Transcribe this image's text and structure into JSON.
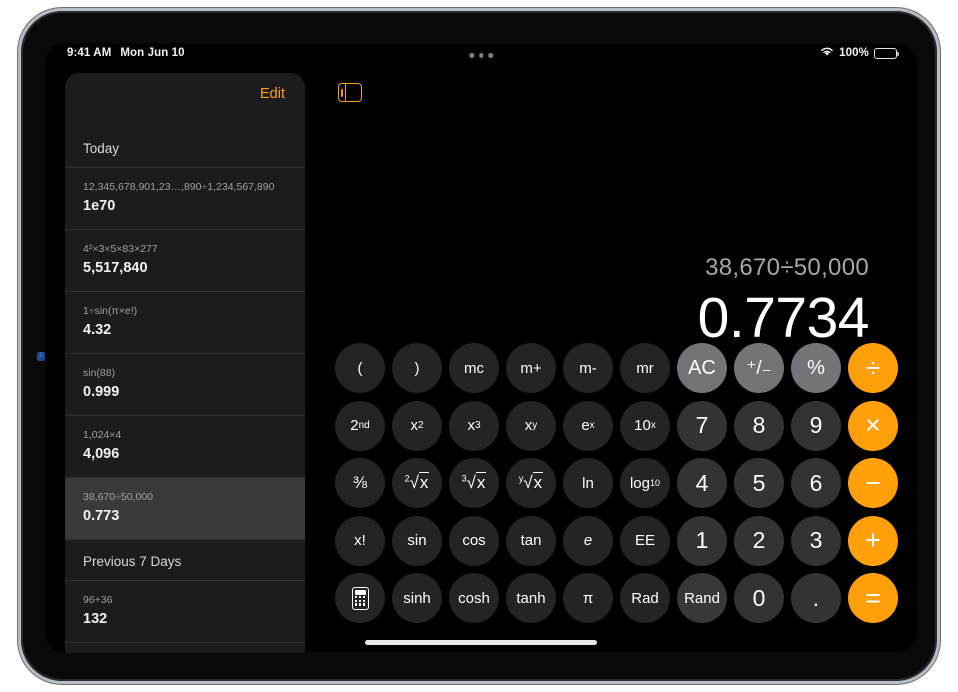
{
  "status_bar": {
    "time": "9:41 AM",
    "date": "Mon Jun 10",
    "wifi_icon": "wifi-icon",
    "battery_percent": "100%"
  },
  "multitask": {
    "icon": "more-dots-icon"
  },
  "sidebar": {
    "edit_label": "Edit",
    "toggle_icon": "sidebar-toggle-icon",
    "sections": [
      {
        "title": "Today",
        "rows": [
          {
            "expression": "12,345,678,901,23…,890÷1,234,567,890",
            "result": "1e70",
            "selected": false
          },
          {
            "expression": "4²×3×5×83×277",
            "result": "5,517,840",
            "selected": false
          },
          {
            "expression": "1÷sin(π×e!)",
            "result": "4.32",
            "selected": false
          },
          {
            "expression": "sin(88)",
            "result": "0.999",
            "selected": false
          },
          {
            "expression": "1,024×4",
            "result": "4,096",
            "selected": false
          },
          {
            "expression": "38,670÷50,000",
            "result": "0.773",
            "selected": true
          }
        ]
      },
      {
        "title": "Previous 7 Days",
        "rows": [
          {
            "expression": "96+36",
            "result": "132",
            "selected": false
          }
        ]
      }
    ]
  },
  "display": {
    "expression": "38,670÷50,000",
    "result": "0.7734"
  },
  "keypad": {
    "rows": [
      [
        {
          "name": "open-paren",
          "label": "(",
          "style": "fn"
        },
        {
          "name": "close-paren",
          "label": ")",
          "style": "fn"
        },
        {
          "name": "memory-clear",
          "label": "mc",
          "style": "fn"
        },
        {
          "name": "memory-add",
          "label": "m+",
          "style": "fn"
        },
        {
          "name": "memory-subtract",
          "label": "m-",
          "style": "fn"
        },
        {
          "name": "memory-recall",
          "label": "mr",
          "style": "fn"
        },
        {
          "name": "all-clear",
          "label": "AC",
          "style": "util"
        },
        {
          "name": "plus-minus",
          "label": "+/-",
          "style": "util"
        },
        {
          "name": "percent",
          "label": "%",
          "style": "util"
        },
        {
          "name": "divide",
          "label": "÷",
          "style": "op"
        }
      ],
      [
        {
          "name": "second-function",
          "label": "2nd",
          "style": "fn",
          "sup": "nd",
          "base": "2"
        },
        {
          "name": "x-squared",
          "label": "x²",
          "style": "fn",
          "sup": "2",
          "base": "x"
        },
        {
          "name": "x-cubed",
          "label": "x³",
          "style": "fn",
          "sup": "3",
          "base": "x"
        },
        {
          "name": "x-to-the-y",
          "label": "xʸ",
          "style": "fn",
          "sup": "y",
          "base": "x"
        },
        {
          "name": "e-to-the-x",
          "label": "eˣ",
          "style": "fn",
          "sup": "x",
          "base": "e"
        },
        {
          "name": "ten-to-the-x",
          "label": "10ˣ",
          "style": "fn",
          "sup": "x",
          "base": "10"
        },
        {
          "name": "digit-7",
          "label": "7",
          "style": "digit"
        },
        {
          "name": "digit-8",
          "label": "8",
          "style": "digit"
        },
        {
          "name": "digit-9",
          "label": "9",
          "style": "digit"
        },
        {
          "name": "multiply",
          "label": "×",
          "style": "op"
        }
      ],
      [
        {
          "name": "reciprocal",
          "label": "1/x",
          "style": "fn"
        },
        {
          "name": "square-root",
          "label": "²√x",
          "style": "fn",
          "root": "2"
        },
        {
          "name": "cube-root",
          "label": "³√x",
          "style": "fn",
          "root": "3"
        },
        {
          "name": "y-root",
          "label": "ʸ√x",
          "style": "fn",
          "root": "y"
        },
        {
          "name": "natural-log",
          "label": "ln",
          "style": "fn"
        },
        {
          "name": "log-base-10",
          "label": "log10",
          "style": "fn",
          "base": "log",
          "sub": "10"
        },
        {
          "name": "digit-4",
          "label": "4",
          "style": "digit"
        },
        {
          "name": "digit-5",
          "label": "5",
          "style": "digit"
        },
        {
          "name": "digit-6",
          "label": "6",
          "style": "digit"
        },
        {
          "name": "subtract",
          "label": "−",
          "style": "op"
        }
      ],
      [
        {
          "name": "factorial",
          "label": "x!",
          "style": "fn"
        },
        {
          "name": "sine",
          "label": "sin",
          "style": "fn"
        },
        {
          "name": "cosine",
          "label": "cos",
          "style": "fn"
        },
        {
          "name": "tangent",
          "label": "tan",
          "style": "fn"
        },
        {
          "name": "euler-number",
          "label": "e",
          "style": "fn",
          "italic": true
        },
        {
          "name": "exponent-entry",
          "label": "EE",
          "style": "fn"
        },
        {
          "name": "digit-1",
          "label": "1",
          "style": "digit"
        },
        {
          "name": "digit-2",
          "label": "2",
          "style": "digit"
        },
        {
          "name": "digit-3",
          "label": "3",
          "style": "digit"
        },
        {
          "name": "add",
          "label": "+",
          "style": "op"
        }
      ],
      [
        {
          "name": "calculator-mode",
          "label": "",
          "style": "fn",
          "icon": "calculator-icon"
        },
        {
          "name": "hyperbolic-sine",
          "label": "sinh",
          "style": "fn"
        },
        {
          "name": "hyperbolic-cosine",
          "label": "cosh",
          "style": "fn"
        },
        {
          "name": "hyperbolic-tangent",
          "label": "tanh",
          "style": "fn"
        },
        {
          "name": "pi",
          "label": "π",
          "style": "fn"
        },
        {
          "name": "radians-toggle",
          "label": "Rad",
          "style": "fn"
        },
        {
          "name": "random",
          "label": "Rand",
          "style": "softdark"
        },
        {
          "name": "digit-0",
          "label": "0",
          "style": "digit"
        },
        {
          "name": "decimal-point",
          "label": ".",
          "style": "digit"
        },
        {
          "name": "equals",
          "label": "=",
          "style": "op"
        }
      ]
    ]
  },
  "colors": {
    "accent_orange": "#ff9f0a",
    "edit_orange": "#ff9f0a",
    "util_gray": "#747478",
    "digit_gray": "#333336",
    "fn_dark": "#242426",
    "sidebar_bg": "#1c1c1e",
    "selected_row": "#3a3a3e"
  }
}
